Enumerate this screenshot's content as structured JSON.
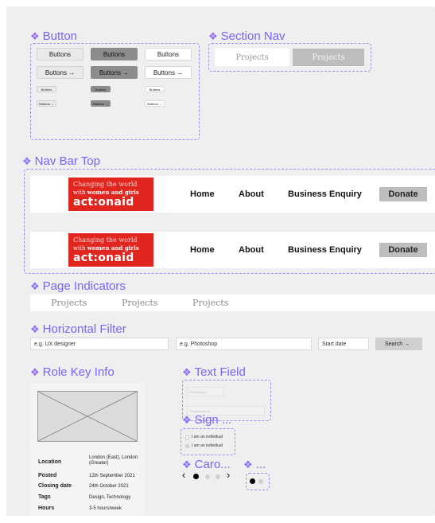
{
  "frames": {
    "button": "Button",
    "section_nav": "Section Nav",
    "nav_bar_top": "Nav Bar Top",
    "page_indicators": "Page Indicators",
    "horizontal_filter": "Horizontal Filter",
    "role_key_info": "Role Key Info",
    "text_field": "Text Field",
    "sign": "Sign ...",
    "carousel": "Caro...",
    "unnamed": "..."
  },
  "buttons": {
    "label": "Buttons",
    "label_arrow": "Buttons →",
    "tiny_label": "Buttons",
    "tiny_label_arrow": "Buttons →"
  },
  "section_nav": {
    "tab1": "Projects",
    "tab2": "Projects"
  },
  "navbar": {
    "logo_line1": "Changing the world",
    "logo_line2_prefix": "with",
    "logo_line2_bold": "women and girls",
    "logo_brand": "act:onaid",
    "links": [
      "Home",
      "About",
      "Business Enquiry"
    ],
    "donate": "Donate"
  },
  "page_indicators": [
    "Projects",
    "Projects",
    "Projects"
  ],
  "horizontal_filter": {
    "keyword_placeholder": "e.g. UX designer",
    "skill_placeholder": "e.g. Photoshop",
    "date_placeholder": "Start date",
    "search_label": "Search →"
  },
  "role_key_info": {
    "rows": [
      {
        "key": "Location",
        "value_line1": "London (East), London",
        "value_line2": "(Greater)"
      },
      {
        "key": "Posted",
        "value_line1": "12th September 2021"
      },
      {
        "key": "Closing date",
        "value_line1": "24th October 2021"
      },
      {
        "key": "Tags",
        "value_line1": "Design, Technology"
      },
      {
        "key": "Hours",
        "value_line1": "3-5 hours/week"
      }
    ]
  },
  "text_field": {
    "first_name_placeholder": "First Name*",
    "email_placeholder": "Email address"
  },
  "sign": {
    "option1": "I am an individual",
    "option2": "I am an individual"
  },
  "carousel": {
    "prev": "‹",
    "next": "›",
    "active_index": 0,
    "dot_count": 4
  },
  "colors": {
    "frame_title": "#7b61ff",
    "brand_red": "#e0261f",
    "canvas": "#efefef"
  }
}
